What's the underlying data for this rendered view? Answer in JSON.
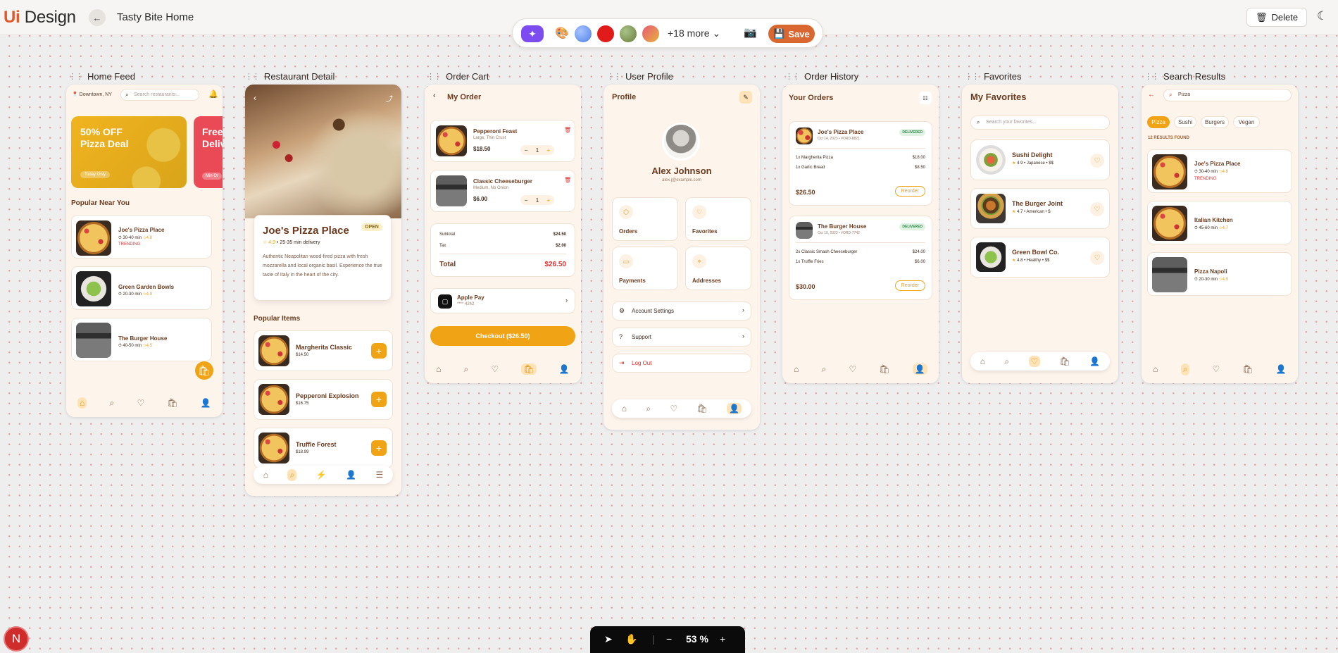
{
  "app": {
    "logo_ui": "Ui",
    "logo_text": "Design",
    "back": "←",
    "page_title": "Tasty Bite Home",
    "delete_label": "Delete",
    "theme_icon": "☾"
  },
  "toolbar": {
    "more_label": "+18 more",
    "save_label": "Save",
    "colors": [
      "#5b86f0",
      "#e11a1a",
      "#8aa05a",
      "#e7793e"
    ]
  },
  "bottom": {
    "zoom": "53 %",
    "minus": "−",
    "plus": "+",
    "user_initial": "N"
  },
  "frames": {
    "home": {
      "label": "Home Feed",
      "location": "Downtown, NY",
      "search_ph": "Search restaurants...",
      "promo1_title": "50% OFF",
      "promo1_sub": "Pizza Deal",
      "promo1_tag": "Today Only",
      "promo2_title": "Free",
      "promo2_sub": "Deliv",
      "promo2_tag": "Min Or",
      "section": "Popular Near You",
      "items": [
        {
          "name": "Joe's Pizza Place",
          "time": "30-40 min",
          "rating": "4.8",
          "tag": "TRENDING"
        },
        {
          "name": "Green Garden Bowls",
          "time": "20-30 min",
          "rating": "4.9",
          "tag": ""
        },
        {
          "name": "The Burger House",
          "time": "40-50 min",
          "rating": "4.5",
          "tag": ""
        }
      ]
    },
    "detail": {
      "label": "Restaurant Detail",
      "title": "Joe's Pizza Place",
      "status": "OPEN",
      "rating": "4.9",
      "delivery": "25-35 min delivery",
      "description": "Authentic Neapolitan wood-fired pizza with fresh mozzarella and local organic basil. Experience the true taste of Italy in the heart of the city.",
      "section": "Popular Items",
      "items": [
        {
          "name": "Margherita Classic",
          "price": "$14.50"
        },
        {
          "name": "Pepperoni Explosion",
          "price": "$16.75"
        },
        {
          "name": "Truffle Forest",
          "price": "$18.99"
        }
      ]
    },
    "cart": {
      "label": "Order Cart",
      "title": "My Order",
      "items": [
        {
          "name": "Pepperoni Feast",
          "sub": "Large, Thin Crust",
          "price": "$18.50",
          "qty": "1"
        },
        {
          "name": "Classic Cheeseburger",
          "sub": "Medium, No Onion",
          "price": "$6.00",
          "qty": "1"
        }
      ],
      "subtotal_label": "Subtotal",
      "subtotal": "$24.50",
      "tax_label": "Tax",
      "tax": "$2.00",
      "total_label": "Total",
      "total": "$26.50",
      "pay_label": "Apple Pay",
      "pay_sub": "**** 4242",
      "checkout": "Checkout ($26.50)"
    },
    "profile": {
      "label": "User Profile",
      "title": "Profile",
      "name": "Alex Johnson",
      "email": "alex.j@example.com",
      "tiles": [
        "Orders",
        "Favorites",
        "Payments",
        "Addresses"
      ],
      "menu": [
        "Account Settings",
        "Support",
        "Log Out"
      ]
    },
    "history": {
      "label": "Order History",
      "title": "Your Orders",
      "orders": [
        {
          "name": "Joe's Pizza Place",
          "meta": "Oct 14, 2023 • #ORD-8821",
          "status": "DELIVERED",
          "lines": [
            {
              "item": "1x Margherita Pizza",
              "price": "$18.00"
            },
            {
              "item": "1x Garlic Bread",
              "price": "$8.50"
            }
          ],
          "total": "$26.50",
          "action": "Reorder"
        },
        {
          "name": "The Burger House",
          "meta": "Oct 10, 2023 • #ORD-7742",
          "status": "DELIVERED",
          "lines": [
            {
              "item": "2x Classic Smash Cheeseburger",
              "price": "$24.00"
            },
            {
              "item": "1x Truffle Fries",
              "price": "$6.00"
            }
          ],
          "total": "$30.00",
          "action": "Reorder"
        }
      ]
    },
    "favorites": {
      "label": "Favorites",
      "title": "My Favorites",
      "search_ph": "Search your favorites...",
      "items": [
        {
          "name": "Sushi Delight",
          "meta": "4.9 • Japanese • $$"
        },
        {
          "name": "The Burger Joint",
          "meta": "4.7 • American • $"
        },
        {
          "name": "Green Bowl Co.",
          "meta": "4.8 • Healthy • $$"
        }
      ]
    },
    "search": {
      "label": "Search Results",
      "query": "Pizza",
      "chips": [
        "Pizza",
        "Sushi",
        "Burgers",
        "Vegan"
      ],
      "count": "12 RESULTS FOUND",
      "items": [
        {
          "name": "Joe's Pizza Place",
          "time": "30-40 min",
          "rating": "4.8",
          "tag": "TRENDING"
        },
        {
          "name": "Italian Kitchen",
          "time": "45-60 min",
          "rating": "4.7",
          "tag": ""
        },
        {
          "name": "Pizza Napoli",
          "time": "20-30 min",
          "rating": "4.9",
          "tag": ""
        }
      ]
    }
  }
}
